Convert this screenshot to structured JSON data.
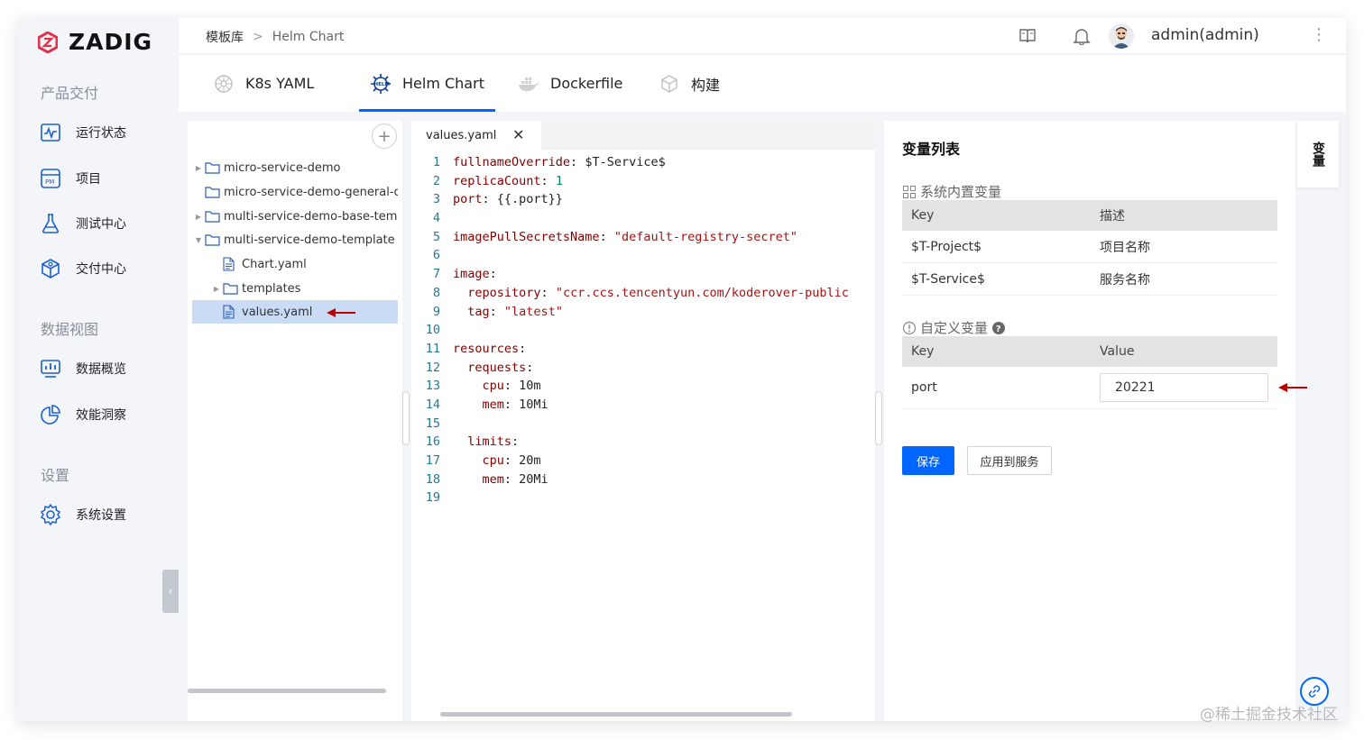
{
  "logo": {
    "text": "ZADIG"
  },
  "sidebar": {
    "sections": [
      {
        "title": "产品交付",
        "items": [
          {
            "label": "运行状态",
            "icon": "activity-monitor-icon"
          },
          {
            "label": "项目",
            "icon": "project-pm-icon"
          },
          {
            "label": "测试中心",
            "icon": "flask-icon"
          },
          {
            "label": "交付中心",
            "icon": "package-icon"
          }
        ]
      },
      {
        "title": "数据视图",
        "items": [
          {
            "label": "数据概览",
            "icon": "bar-chart-icon"
          },
          {
            "label": "效能洞察",
            "icon": "pie-chart-icon"
          }
        ]
      },
      {
        "title": "设置",
        "items": [
          {
            "label": "系统设置",
            "icon": "gear-icon"
          }
        ]
      }
    ]
  },
  "header": {
    "breadcrumb_root": "模板库",
    "breadcrumb_sep": ">",
    "breadcrumb_current": "Helm Chart",
    "username": "admin(admin)"
  },
  "tabs": [
    {
      "label": "K8s YAML",
      "icon": "kubernetes-icon"
    },
    {
      "label": "Helm Chart",
      "icon": "helm-icon"
    },
    {
      "label": "Dockerfile",
      "icon": "docker-icon"
    },
    {
      "label": "构建",
      "icon": "cube-icon"
    }
  ],
  "active_tab": "Helm Chart",
  "tree": {
    "add_symbol": "+",
    "items": [
      {
        "label": "micro-service-demo",
        "type": "folder",
        "expand": "collapsed",
        "depth": 0
      },
      {
        "label": "micro-service-demo-general-chart",
        "type": "folder",
        "expand": "none",
        "depth": 0
      },
      {
        "label": "multi-service-demo-base-template",
        "type": "folder",
        "expand": "collapsed",
        "depth": 0
      },
      {
        "label": "multi-service-demo-template",
        "type": "folder",
        "expand": "expanded",
        "depth": 0
      },
      {
        "label": "Chart.yaml",
        "type": "file",
        "expand": "none",
        "depth": 1
      },
      {
        "label": "templates",
        "type": "folder",
        "expand": "collapsed",
        "depth": 1
      },
      {
        "label": "values.yaml",
        "type": "file",
        "expand": "none",
        "depth": 1,
        "selected": true
      }
    ]
  },
  "editor": {
    "tab_label": "values.yaml",
    "close_symbol": "✕",
    "lines": [
      [
        [
          "k",
          "fullnameOverride"
        ],
        [
          "p",
          ": "
        ],
        [
          "v",
          "$T-Service$"
        ]
      ],
      [
        [
          "k",
          "replicaCount"
        ],
        [
          "p",
          ": "
        ],
        [
          "n",
          "1"
        ]
      ],
      [
        [
          "k",
          "port"
        ],
        [
          "p",
          ": "
        ],
        [
          "v",
          "{{.port}}"
        ]
      ],
      [],
      [
        [
          "k",
          "imagePullSecretsName"
        ],
        [
          "p",
          ": "
        ],
        [
          "s",
          "\"default-registry-secret\""
        ]
      ],
      [],
      [
        [
          "k",
          "image"
        ],
        [
          "p",
          ":"
        ]
      ],
      [
        [
          "p",
          "  "
        ],
        [
          "k",
          "repository"
        ],
        [
          "p",
          ": "
        ],
        [
          "s",
          "\"ccr.ccs.tencentyun.com/koderover-public"
        ]
      ],
      [
        [
          "p",
          "  "
        ],
        [
          "k",
          "tag"
        ],
        [
          "p",
          ": "
        ],
        [
          "s",
          "\"latest\""
        ]
      ],
      [],
      [
        [
          "k",
          "resources"
        ],
        [
          "p",
          ":"
        ]
      ],
      [
        [
          "p",
          "  "
        ],
        [
          "k",
          "requests"
        ],
        [
          "p",
          ":"
        ]
      ],
      [
        [
          "p",
          "    "
        ],
        [
          "k",
          "cpu"
        ],
        [
          "p",
          ": "
        ],
        [
          "v",
          "10m"
        ]
      ],
      [
        [
          "p",
          "    "
        ],
        [
          "k",
          "mem"
        ],
        [
          "p",
          ": "
        ],
        [
          "v",
          "10Mi"
        ]
      ],
      [],
      [
        [
          "p",
          "  "
        ],
        [
          "k",
          "limits"
        ],
        [
          "p",
          ":"
        ]
      ],
      [
        [
          "p",
          "    "
        ],
        [
          "k",
          "cpu"
        ],
        [
          "p",
          ": "
        ],
        [
          "v",
          "20m"
        ]
      ],
      [
        [
          "p",
          "    "
        ],
        [
          "k",
          "mem"
        ],
        [
          "p",
          ": "
        ],
        [
          "v",
          "20Mi"
        ]
      ],
      []
    ]
  },
  "variables": {
    "title": "变量列表",
    "system_title": "系统内置变量",
    "system_headers": [
      "Key",
      "描述"
    ],
    "system_rows": [
      {
        "key": "$T-Project$",
        "desc": "项目名称"
      },
      {
        "key": "$T-Service$",
        "desc": "服务名称"
      }
    ],
    "custom_title": "自定义变量",
    "custom_headers": [
      "Key",
      "Value"
    ],
    "custom_rows": [
      {
        "key": "port",
        "value": "20221"
      }
    ],
    "save_label": "保存",
    "apply_label": "应用到服务",
    "side_tab_label": "变量"
  },
  "colors": {
    "accent": "#0066ff",
    "annotation_arrow": "#c00000",
    "selected_row": "#c9dbf5"
  },
  "watermark": "@稀土掘金技术社区"
}
